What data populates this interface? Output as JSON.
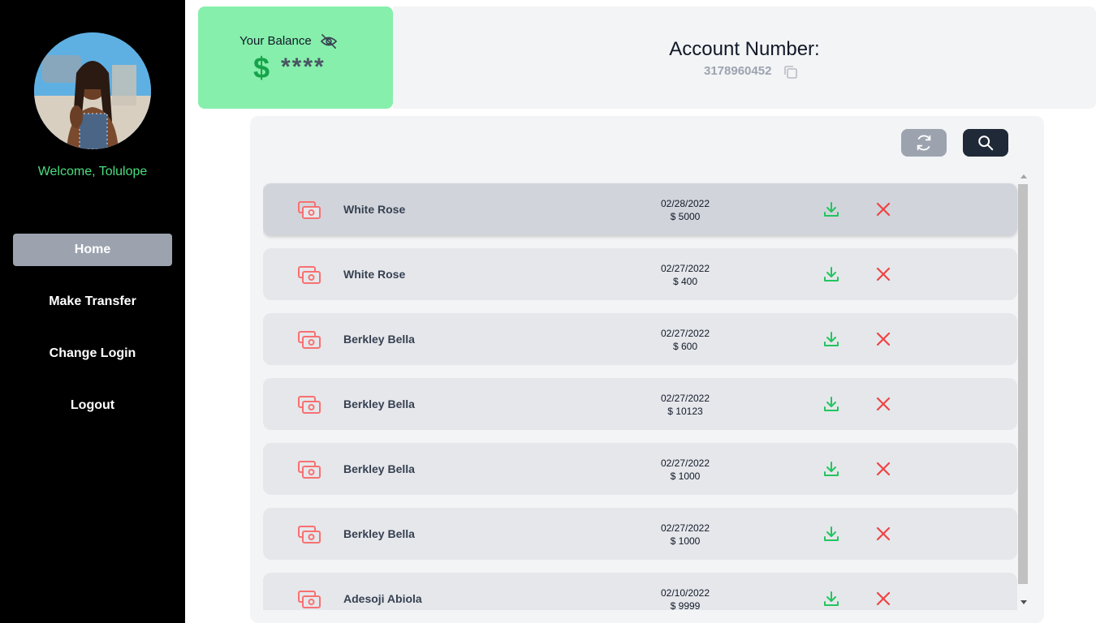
{
  "sidebar": {
    "welcome": "Welcome, Tolulope",
    "nav": [
      {
        "label": "Home",
        "active": true
      },
      {
        "label": "Make Transfer",
        "active": false
      },
      {
        "label": "Change Login",
        "active": false
      },
      {
        "label": "Logout",
        "active": false
      }
    ]
  },
  "balance": {
    "label": "Your Balance",
    "currency_symbol": "$",
    "value": "****",
    "toggle_icon": "eye-off-icon"
  },
  "account": {
    "title": "Account Number:",
    "number": "3178960452",
    "copy_icon": "copy-icon"
  },
  "toolbar": {
    "refresh_icon": "refresh-icon",
    "search_icon": "search-icon"
  },
  "transactions": [
    {
      "name": "White Rose",
      "date": "02/28/2022",
      "amount": "$ 5000"
    },
    {
      "name": "White Rose",
      "date": "02/27/2022",
      "amount": "$ 400"
    },
    {
      "name": "Berkley Bella",
      "date": "02/27/2022",
      "amount": "$ 600"
    },
    {
      "name": "Berkley Bella",
      "date": "02/27/2022",
      "amount": "$ 10123"
    },
    {
      "name": "Berkley Bella",
      "date": "02/27/2022",
      "amount": "$ 1000"
    },
    {
      "name": "Berkley Bella",
      "date": "02/27/2022",
      "amount": "$ 1000"
    },
    {
      "name": "Adesoji Abiola",
      "date": "02/10/2022",
      "amount": "$ 9999"
    }
  ],
  "colors": {
    "sidebar_bg": "#000000",
    "accent_green": "#4ade80",
    "balance_card": "#86efac",
    "money_icon": "#f87171",
    "download": "#22c55e",
    "delete": "#ef4444",
    "search_button": "#1f2937",
    "refresh_button": "#9ca3af"
  }
}
